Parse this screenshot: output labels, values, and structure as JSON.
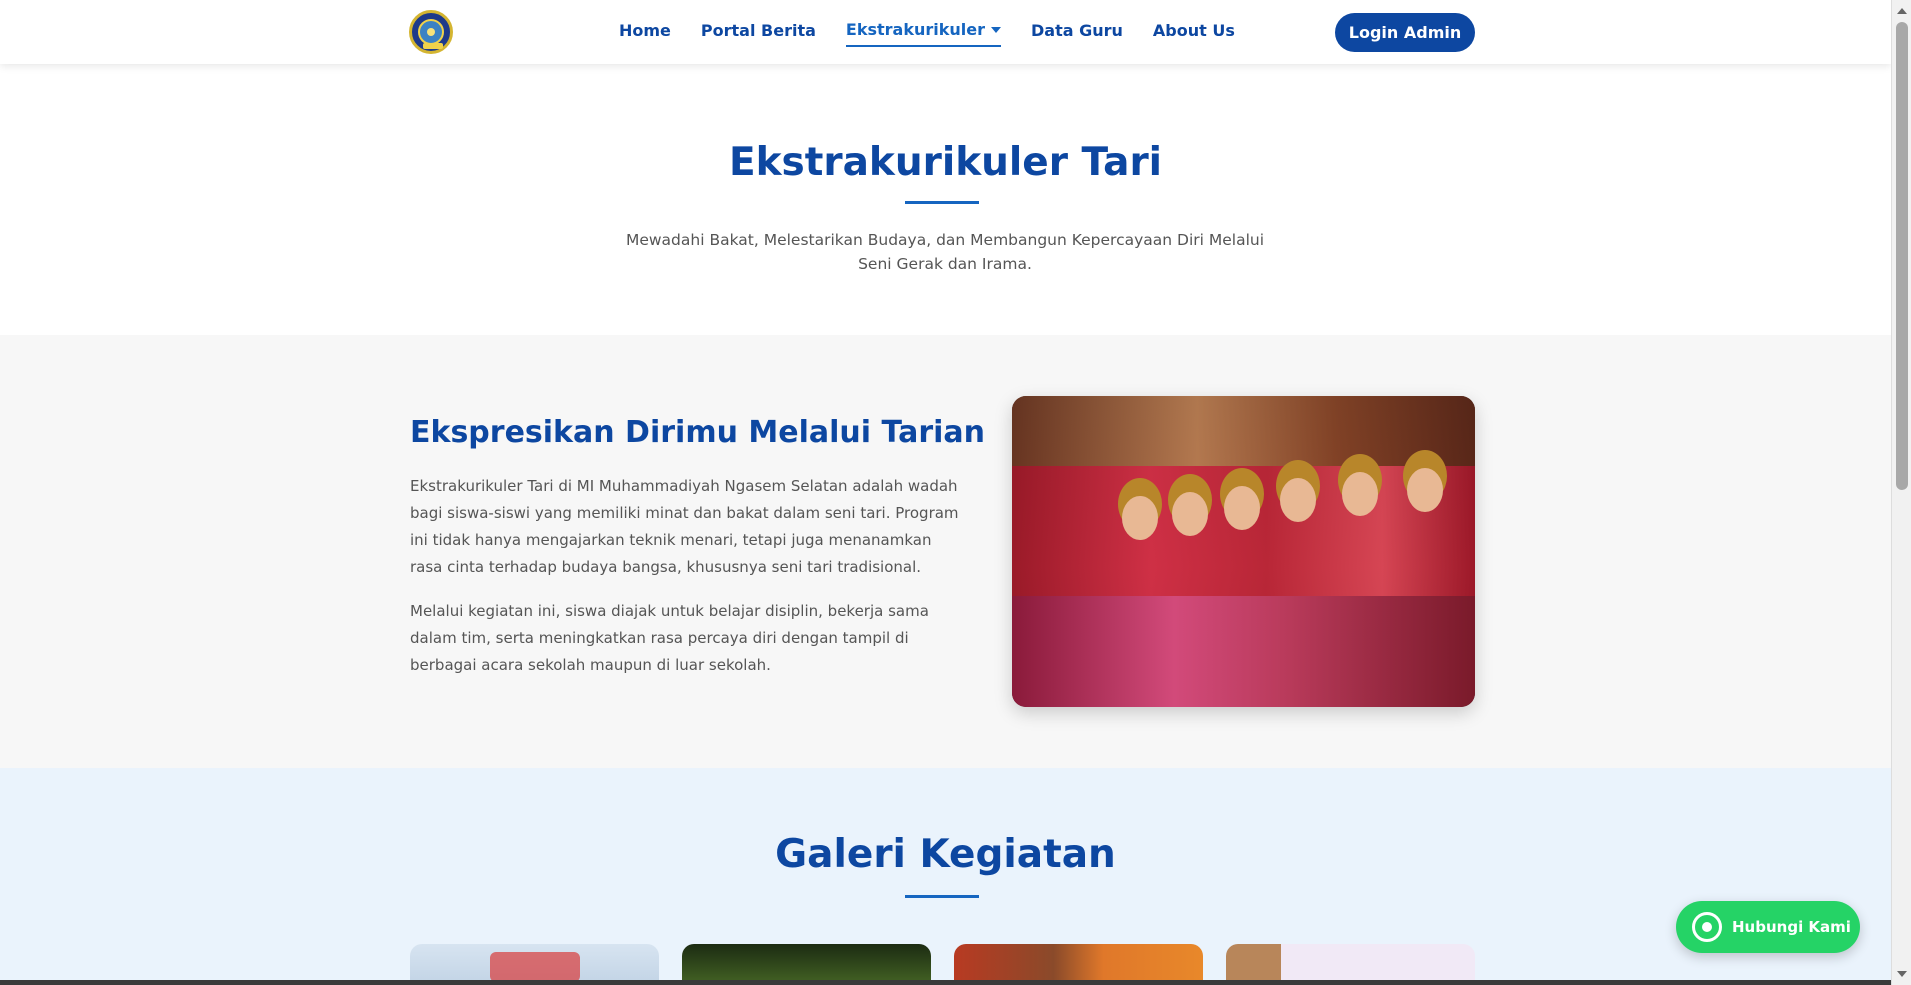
{
  "navbar": {
    "logo_name": "school-logo",
    "items": [
      {
        "label": "Home"
      },
      {
        "label": "Portal Berita"
      },
      {
        "label": "Ekstrakurikuler",
        "active": true,
        "dropdown": true
      },
      {
        "label": "Data Guru"
      },
      {
        "label": "About Us"
      }
    ],
    "login_label": "Login Admin"
  },
  "hero": {
    "title": "Ekstrakurikuler Tari",
    "subtitle": "Mewadahi Bakat, Melestarikan Budaya, dan Membangun Kepercayaan Diri Melalui Seni Gerak dan Irama."
  },
  "about": {
    "title": "Ekspresikan Dirimu Melalui Tarian",
    "paragraph1": "Ekstrakurikuler Tari di MI Muhammadiyah Ngasem Selatan adalah wadah bagi siswa-siswi yang memiliki minat dan bakat dalam seni tari. Program ini tidak hanya mengajarkan teknik menari, tetapi juga menanamkan rasa cinta terhadap budaya bangsa, khususnya seni tari tradisional.",
    "paragraph2": "Melalui kegiatan ini, siswa diajak untuk belajar disiplin, bekerja sama dalam tim, serta meningkatkan rasa percaya diri dengan tampil di berbagai acara sekolah maupun di luar sekolah."
  },
  "gallery": {
    "title": "Galeri Kegiatan"
  },
  "whatsapp": {
    "label": "Hubungi Kami",
    "icon": "whatsapp-icon",
    "color": "#25d366"
  },
  "colors": {
    "primary": "#0d47a1",
    "accent": "#1565c0"
  }
}
